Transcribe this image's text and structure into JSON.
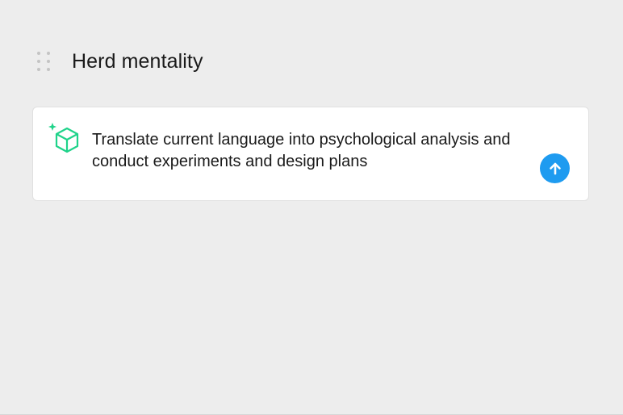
{
  "header": {
    "title": "Herd mentality"
  },
  "prompt_card": {
    "text": "Translate current language into psychological analysis and conduct experiments and design plans",
    "icon": "sparkle-cube-icon",
    "send_icon": "arrow-up-icon"
  },
  "colors": {
    "background": "#ededed",
    "card": "#ffffff",
    "accent_green": "#1fd38a",
    "send_blue": "#1e9bf0"
  }
}
